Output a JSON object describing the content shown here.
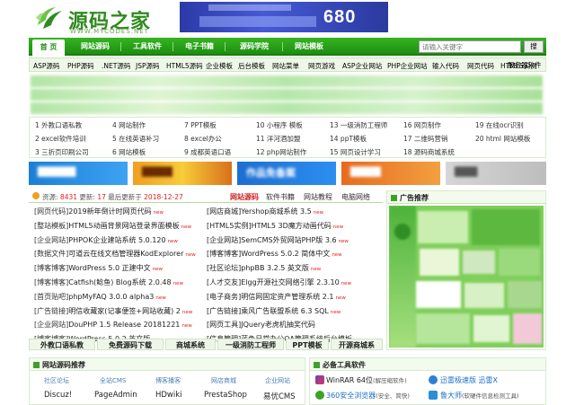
{
  "site": {
    "name": "源码之家",
    "domain": "WWW.MYCODES.NET"
  },
  "banner": {
    "number": "680"
  },
  "nav": {
    "items": [
      "首 页",
      "网站源码",
      "工具软件",
      "电子书籍",
      "源码学院",
      "网站模板"
    ]
  },
  "search": {
    "placeholder": "请输入关键字",
    "button": "搜"
  },
  "categories": [
    "ASP源码",
    "PHP源码",
    ".NET源码",
    "JSP源码",
    "HTML5源码",
    "企业模板",
    "后台模板",
    "网站菜单",
    "网页游戏",
    "ASP企业网站",
    "PHP企业网站",
    "输入代码",
    "网页代码",
    "HTML5实例",
    "服务器软件"
  ],
  "quick_links": [
    [
      "1 外教口语私教",
      "4 网站制作",
      "7 PPT模板",
      "10 小程序 模板",
      "13 一级消防工程师",
      "16 网页制作",
      "19 在线ocr识别"
    ],
    [
      "2 excel软件培训",
      "5 在线英语补习",
      "8 excel办公",
      "11 洋河酒加盟",
      "14 ppT模板",
      "17 二维码营销",
      "20 html 网站模板"
    ],
    [
      "3 三折页印刷公司",
      "6 网站模板",
      "9 成都英语口语",
      "12 php网站制作",
      "15 网页设计学习",
      "18 源码商城系统",
      ""
    ]
  ],
  "ads": {
    "ad3": "作品免备案"
  },
  "source_panel": {
    "stats": {
      "label_resources": "资源:",
      "resources": "8431",
      "label_updated": "更新:",
      "updated": "17",
      "label_last": "最后更新于",
      "last_update": "2018-12-27"
    },
    "tabs": [
      "网站源码",
      "软件书籍",
      "网站教程",
      "电脑网络"
    ],
    "left_items": [
      {
        "cat": "[网页代码]",
        "title": "2019新年倒计时网页代码",
        "new": "new"
      },
      {
        "cat": "[整站模板]",
        "title": "HTML5动画背景网站登录界面模板",
        "new": "new"
      },
      {
        "cat": "[企业网站]",
        "title": "PHPOK企业建站系统 5.0.120",
        "new": "new"
      },
      {
        "cat": "[数据文件]",
        "title": "可道云在线文档管理器KodExplorer",
        "new": "new"
      },
      {
        "cat": "[博客博客]",
        "title": "WordPress 5.0 正建中文",
        "new": "new"
      },
      {
        "cat": "[博客博客]",
        "title": "Catfish(鲶鱼) Blog系统 2.0.48",
        "new": "new"
      },
      {
        "cat": "[首页贴吧]",
        "title": "phpMyFAQ 3.0.0 alpha3",
        "new": "new"
      },
      {
        "cat": "[广告链接]",
        "title": "明信收藏家(记事便签+网站收藏) 2",
        "new": "new"
      },
      {
        "cat": "[企业网站]",
        "title": "DouPHP 1.5 Release 20181221",
        "new": "new"
      },
      {
        "cat": "[博客博客]",
        "title": "WordPress 5.0.2 英文版",
        "new": ""
      }
    ],
    "right_items": [
      {
        "cat": "[网店商城]",
        "title": "Yershop商城系统 3.5",
        "new": "new"
      },
      {
        "cat": "[HTML5实例]",
        "title": "HTML5 3D魔方动画代码",
        "new": "new"
      },
      {
        "cat": "[企业网站]",
        "title": "SemCMS外贸网站PHP版 3.6",
        "new": "new"
      },
      {
        "cat": "[博客博客]",
        "title": "WordPress 5.0.2 简体中文",
        "new": "new"
      },
      {
        "cat": "[社区论坛]",
        "title": "phpBB 3.2.5 英文版",
        "new": "new"
      },
      {
        "cat": "[人才交友]",
        "title": "Elgg开源社交网络引擎 2.3.10",
        "new": "new"
      },
      {
        "cat": "[电子商务]",
        "title": "明信网固定资产管理系统 2.1",
        "new": "new"
      },
      {
        "cat": "[广告链接]",
        "title": "乘风广告联盟系统 6.3 SQL",
        "new": "new"
      },
      {
        "cat": "[网页工具]",
        "title": "JQuery老虎机抽奖代码",
        "new": ""
      },
      {
        "cat": "[信息管理]",
        "title": "蓝色日常办公OA管理系统后台模板",
        "new": ""
      }
    ],
    "tags": [
      "外教口语私教",
      "免费源码下载",
      "商城系统",
      "一级消防工程师",
      "PPT模板",
      "开源商城系"
    ]
  },
  "ad_recommend": {
    "title": "广告推荐"
  },
  "recommend": {
    "title": "网站源码推荐",
    "cats": [
      "社区论坛",
      "全站CMS",
      "博客播客",
      "网店商城",
      "企业网站"
    ],
    "names": [
      "Discuz!",
      "PageAdmin",
      "HDwiki",
      "PrestaShop",
      "易优CMS"
    ]
  },
  "software": {
    "title": "必备工具软件",
    "items": [
      {
        "name": "WinRAR",
        "note": "64位",
        "desc": "(解压缩软件)"
      },
      {
        "name": "迅雷极速版",
        "note": "迅雷X",
        "desc": ""
      },
      {
        "name": "360安全浏览器",
        "note": "",
        "desc": "(安全、简快)"
      },
      {
        "name": "鲁大师",
        "note": "",
        "desc": "(软硬件信息检测工具)"
      }
    ]
  },
  "colors": {
    "brand_green": "#2e8b1e",
    "nav_green": "#1e8f12",
    "accent_red": "#e51b1b"
  }
}
